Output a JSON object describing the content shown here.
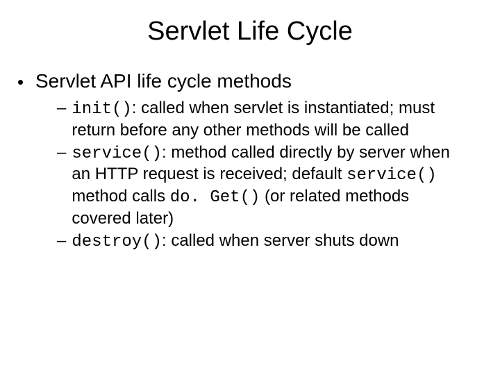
{
  "title": "Servlet Life Cycle",
  "bullet1": "Servlet API life cycle methods",
  "items": [
    {
      "code": "init()",
      "text_after": ": called when servlet is instantiated; must return before any other methods will be called"
    },
    {
      "code": "service()",
      "text_after": ": method called directly by server when an HTTP request is received; default ",
      "code2": "service()",
      "text_mid": " method calls ",
      "code3": "do. Get()",
      "text_end": " (or related methods covered later)"
    },
    {
      "code": "destroy()",
      "text_after": ": called when server shuts down"
    }
  ]
}
